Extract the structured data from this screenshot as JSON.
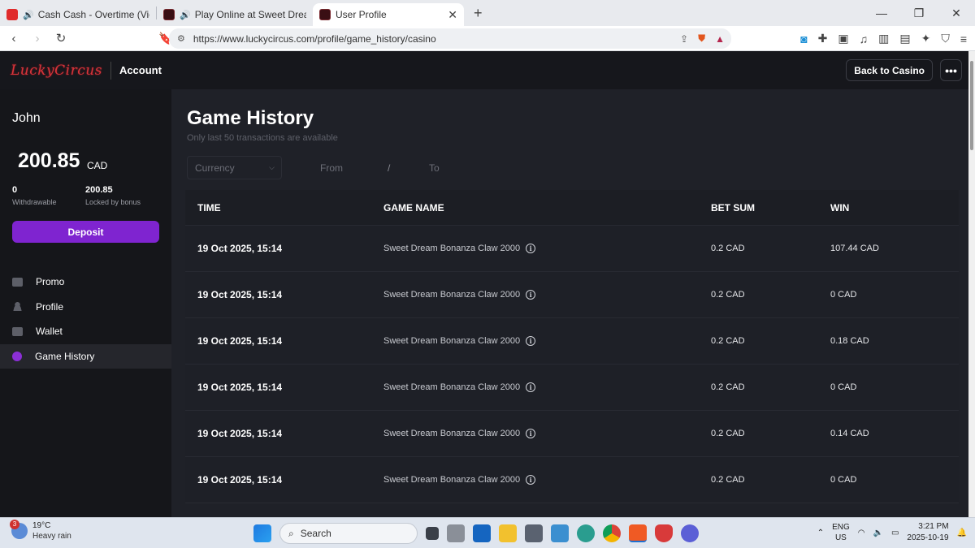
{
  "browser": {
    "tabs": [
      {
        "title": "Cash Cash - Overtime (Vicetone R",
        "favicon_color": "#e02b2b"
      },
      {
        "title": "Play Online at Sweet Dream Bona",
        "favicon_color": "#3a0f14"
      },
      {
        "title": "User Profile",
        "favicon_color": "#3a0f14"
      }
    ],
    "url": "https://www.luckycircus.com/profile/game_history/casino"
  },
  "header": {
    "logo": "LuckyCircus",
    "section": "Account",
    "back_label": "Back to Casino",
    "more_label": "•••"
  },
  "sidebar": {
    "user_name": "John",
    "balance": "200.85",
    "currency": "CAD",
    "withdrawable_value": "0",
    "withdrawable_label": "Withdrawable",
    "locked_value": "200.85",
    "locked_label": "Locked by bonus",
    "deposit_label": "Deposit",
    "items": [
      {
        "label": "Promo",
        "icon": "gift-icon"
      },
      {
        "label": "Profile",
        "icon": "user-icon"
      },
      {
        "label": "Wallet",
        "icon": "wallet-icon"
      },
      {
        "label": "Game History",
        "icon": "clock-icon"
      }
    ],
    "active_item": "Game History"
  },
  "main": {
    "title": "Game History",
    "subtitle": "Only last 50 transactions are available",
    "filters": {
      "currency_placeholder": "Currency",
      "from_placeholder": "From",
      "separator": "/",
      "to_placeholder": "To"
    },
    "columns": [
      "TIME",
      "GAME NAME",
      "BET SUM",
      "WIN"
    ],
    "rows": [
      {
        "time": "19 Oct 2025, 15:14",
        "game": "Sweet Dream Bonanza Claw 2000",
        "bet": "0.2 CAD",
        "win": "107.44 CAD"
      },
      {
        "time": "19 Oct 2025, 15:14",
        "game": "Sweet Dream Bonanza Claw 2000",
        "bet": "0.2 CAD",
        "win": "0 CAD"
      },
      {
        "time": "19 Oct 2025, 15:14",
        "game": "Sweet Dream Bonanza Claw 2000",
        "bet": "0.2 CAD",
        "win": "0.18 CAD"
      },
      {
        "time": "19 Oct 2025, 15:14",
        "game": "Sweet Dream Bonanza Claw 2000",
        "bet": "0.2 CAD",
        "win": "0 CAD"
      },
      {
        "time": "19 Oct 2025, 15:14",
        "game": "Sweet Dream Bonanza Claw 2000",
        "bet": "0.2 CAD",
        "win": "0.14 CAD"
      },
      {
        "time": "19 Oct 2025, 15:14",
        "game": "Sweet Dream Bonanza Claw 2000",
        "bet": "0.2 CAD",
        "win": "0 CAD"
      }
    ]
  },
  "taskbar": {
    "weather_temp": "19°C",
    "weather_desc": "Heavy rain",
    "weather_badge": "3",
    "search_label": "Search",
    "lang": "ENG",
    "region": "US",
    "time": "3:21 PM",
    "date": "2025-10-19"
  },
  "colors": {
    "accent": "#7f24d0",
    "logo": "#d9343b",
    "background": "#1f2128",
    "sidebar": "#15161a"
  }
}
